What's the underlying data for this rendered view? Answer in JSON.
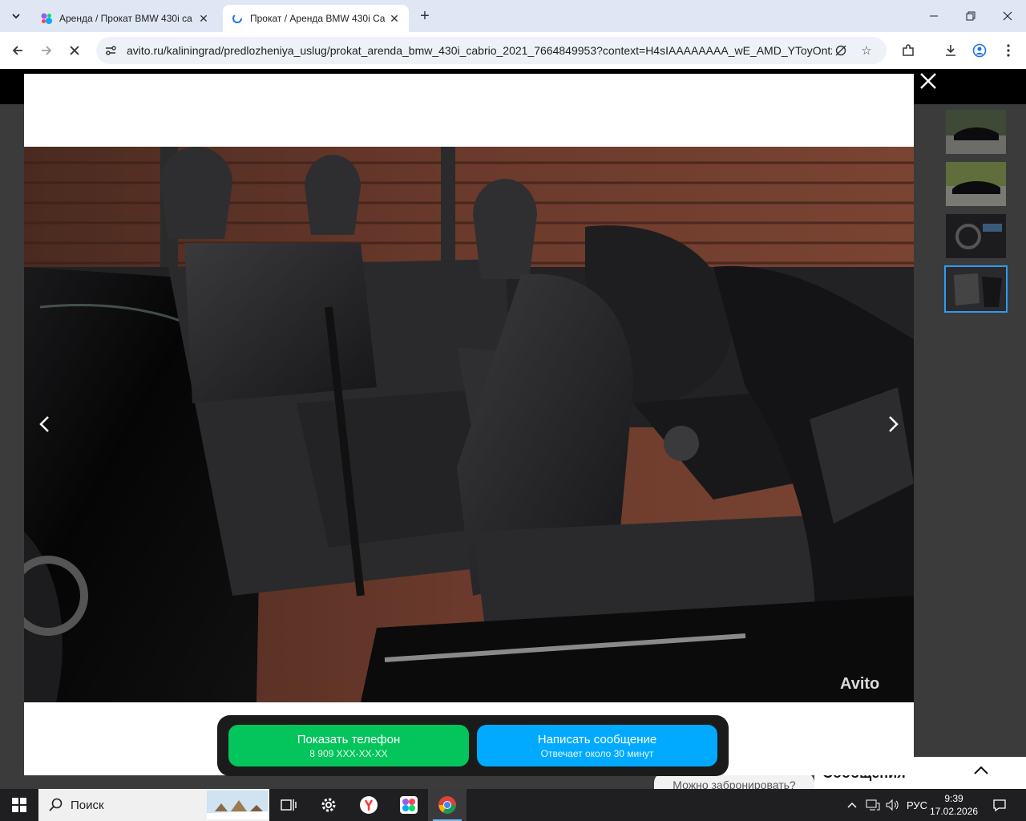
{
  "browser": {
    "tabs": [
      {
        "title": "Аренда / Прокат BMW 430i ca",
        "active": false
      },
      {
        "title": "Прокат / Аренда BMW 430i Ca",
        "active": true
      }
    ],
    "url": "avito.ru/kaliningrad/predlozheniya_uslug/prokat_arenda_bmw_430i_cabrio_2021_7664849953?context=H4sIAAAAAAAA_wE_AMD_YToyOntz..."
  },
  "gallery": {
    "watermark": "Avito",
    "thumbnails": [
      {
        "label": "exterior-front",
        "active": false
      },
      {
        "label": "exterior-side",
        "active": false
      },
      {
        "label": "interior-dashboard",
        "active": false
      },
      {
        "label": "interior-seats",
        "active": true
      }
    ]
  },
  "actions": {
    "phone_label": "Показать телефон",
    "phone_number": "8 909 XXX-XX-XX",
    "message_label": "Написать сообщение",
    "message_sub": "Отвечает около 30 минут"
  },
  "page_behind": {
    "booking_prompt": "Можно забронировать?",
    "messages_label": "Сообщения"
  },
  "taskbar": {
    "search_label": "Поиск",
    "language": "РУС",
    "time": "9:39",
    "date": "17.02.2026"
  },
  "colors": {
    "phone_button": "#04c45c",
    "message_button": "#01aaff",
    "thumb_active_border": "#2f9bf0"
  }
}
